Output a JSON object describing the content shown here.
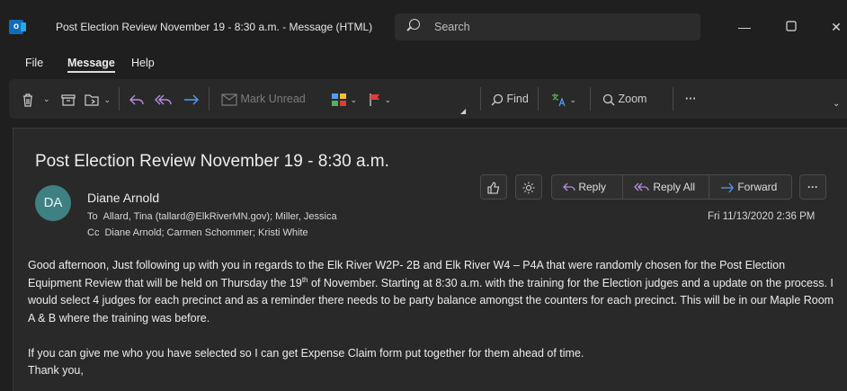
{
  "window": {
    "title": "Post Election Review November 19 - 8:30 a.m.  -  Message (HTML)",
    "search_placeholder": "Search",
    "app_icon_letter": "o"
  },
  "menu": {
    "file": "File",
    "message": "Message",
    "help": "Help"
  },
  "ribbon": {
    "mark_unread": "Mark Unread",
    "find": "Find",
    "zoom": "Zoom",
    "more": "···"
  },
  "email": {
    "subject": "Post Election Review November 19 - 8:30 a.m.",
    "avatar_initials": "DA",
    "sender": "Diane Arnold",
    "to_label": "To",
    "to": "Allard, Tina (tallard@ElkRiverMN.gov); Miller, Jessica",
    "cc_label": "Cc",
    "cc": "Diane Arnold; Carmen Schommer; Kristi White",
    "date": "Fri 11/13/2020 2:36 PM",
    "actions": {
      "reply": "Reply",
      "reply_all": "Reply All",
      "forward": "Forward",
      "more": "···"
    },
    "body": {
      "p1_before_sup": "Good afternoon, Just following up with you in regards to the Elk River W2P- 2B and Elk River W4 – P4A that were randomly chosen for the Post Election Equipment Review that will be held on Thursday the 19",
      "p1_sup": "th",
      "p1_after_sup": " of November. Starting at 8:30 a.m. with the training for the Election judges and a update on the process.  I would select 4 judges for each precinct and as a reminder there needs to be party balance amongst the counters for each precinct. This will be in our Maple Room  A & B where the training was before.",
      "p2": "If you can give me who you have selected so I can get Expense Claim form put together for them ahead of time.",
      "p3": "Thank you,"
    }
  },
  "colors": {
    "avatar_bg": "#3f8082",
    "accent_blue": "#4f9ef0",
    "flag_red": "#e03b3b"
  }
}
